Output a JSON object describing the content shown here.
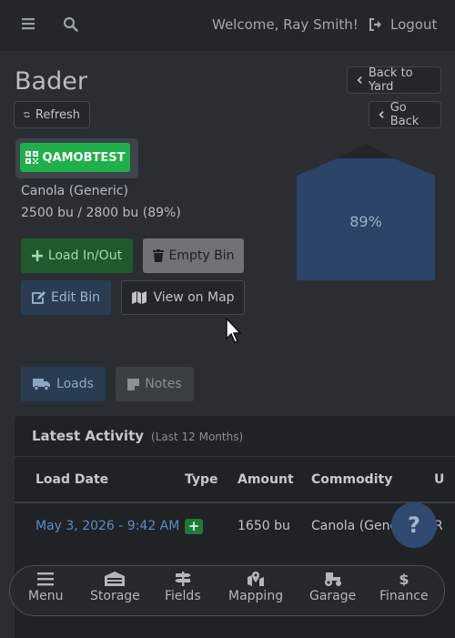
{
  "topbar": {
    "welcome": "Welcome, Ray Smith!",
    "logout_label": "Logout"
  },
  "page": {
    "title": "Bader",
    "refresh_label": "Refresh",
    "back_to_yard_label": "Back to Yard",
    "go_back_label": "Go Back"
  },
  "bin": {
    "tag": "QAMOBTEST",
    "commodity": "Canola (Generic)",
    "capacity": "2500 bu / 2800 bu (89%)",
    "fill_percent_label": "89%",
    "fill_fraction": 0.89
  },
  "actions": {
    "load_label": "Load In/Out",
    "empty_label": "Empty Bin",
    "edit_label": "Edit Bin",
    "map_label": "View on Map"
  },
  "tabs": {
    "loads": "Loads",
    "notes": "Notes"
  },
  "activity": {
    "title": "Latest Activity",
    "subtitle": "(Last 12 Months)",
    "columns": [
      "Load Date",
      "Type",
      "Amount",
      "Commodity",
      "U"
    ],
    "rows": [
      {
        "date": "May 3, 2026 - 9:42 AM",
        "type_icon": "plus-icon",
        "amount": "1650 bu",
        "commodity": "Canola (Gene",
        "unit": "R"
      }
    ]
  },
  "help_label": "?",
  "bottom_nav": {
    "items": [
      {
        "label": "Menu",
        "icon": "menu-icon"
      },
      {
        "label": "Storage",
        "icon": "storage-icon"
      },
      {
        "label": "Fields",
        "icon": "signpost-icon"
      },
      {
        "label": "Mapping",
        "icon": "map-marker-icon"
      },
      {
        "label": "Garage",
        "icon": "tractor-icon"
      },
      {
        "label": "Finance",
        "icon": "dollar-icon"
      }
    ]
  },
  "colors": {
    "background": "#2a2e32",
    "bin_fill": "#2b4468",
    "qr_tag": "#20b04a",
    "link": "#5b8bc5"
  }
}
